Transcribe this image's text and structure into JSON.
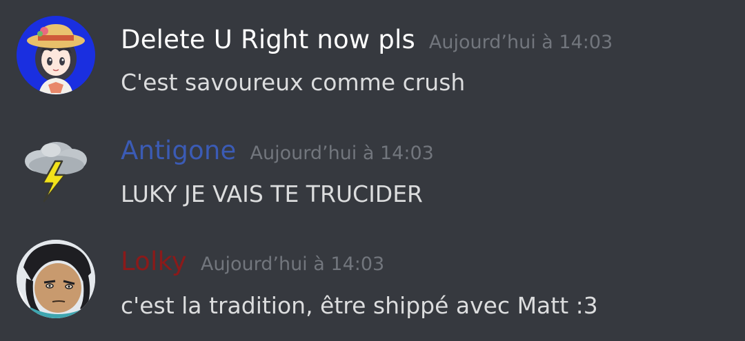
{
  "messages": [
    {
      "username": "Delete U Right now pls",
      "username_color": "#ffffff",
      "timestamp": "Aujourd’hui à 14:03",
      "content": "C'est savoureux comme crush",
      "avatar_icon": "anime-girl-avatar"
    },
    {
      "username": "Antigone",
      "username_color": "#3b5bb5",
      "timestamp": "Aujourd’hui à 14:03",
      "content": "LUKY JE VAIS TE TRUCIDER",
      "avatar_icon": "thunder-cloud-icon"
    },
    {
      "username": "Lolky",
      "username_color": "#8b1a1a",
      "timestamp": "Aujourd’hui à 14:03",
      "content": "c'est la tradition, être shippé avec Matt :3",
      "avatar_icon": "anime-boy-avatar"
    }
  ]
}
